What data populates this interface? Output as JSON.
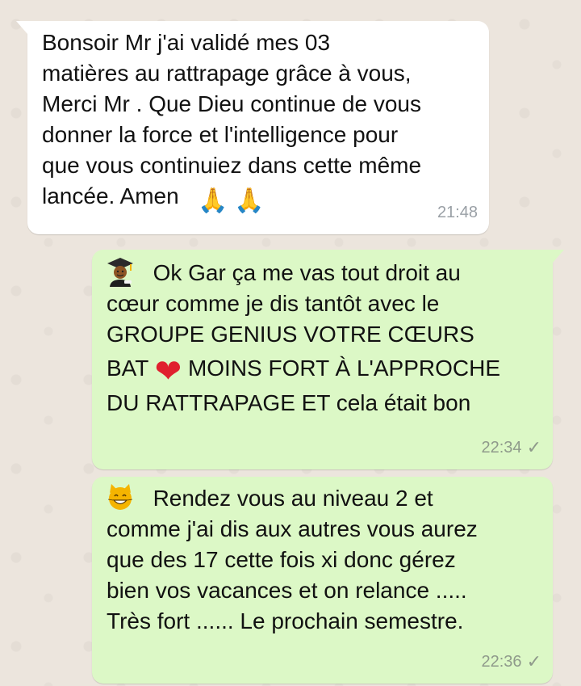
{
  "messages": [
    {
      "direction": "incoming",
      "lines": [
        "Bonsoir Mr j'ai validé mes 03",
        "matières au rattrapage grâce à vous,",
        "Merci Mr . Que Dieu continue de vous",
        "donner la force et l'intelligence pour",
        "que vous continuiez dans cette même",
        "lancée. Amen"
      ],
      "emojis_end": [
        "folded-hands-emoji",
        "folded-hands-emoji"
      ],
      "time": "21:48"
    },
    {
      "direction": "outgoing",
      "emoji_start": "graduate-emoji",
      "lines": [
        "Ok Gar ça me vas tout droit au",
        "cœur comme je dis tantôt avec le",
        "GROUPE GENIUS VOTRE CŒURS",
        "BAT",
        "MOINS FORT À L'APPROCHE",
        "DU RATTRAPAGE ET cela était bon"
      ],
      "inline_emoji": "red-heart-emoji",
      "time": "22:34",
      "status": "sent-check"
    },
    {
      "direction": "outgoing",
      "emoji_start": "grinning-cat-emoji",
      "lines": [
        "Rendez vous au niveau 2 et",
        "comme j'ai dis aux autres vous aurez",
        "que des 17 cette fois xi donc gérez",
        "bien vos vacances et on relance .....",
        "Très fort ...... Le prochain semestre."
      ],
      "time": "22:36",
      "status": "sent-check"
    }
  ],
  "glyphs": {
    "pray": "🙏",
    "heart": "❤",
    "check": "✓"
  },
  "colors": {
    "chat_background": "#ece5dd",
    "incoming_bubble": "#ffffff",
    "outgoing_bubble": "#dcf8c6",
    "meta_text": "#8f9a8b"
  }
}
